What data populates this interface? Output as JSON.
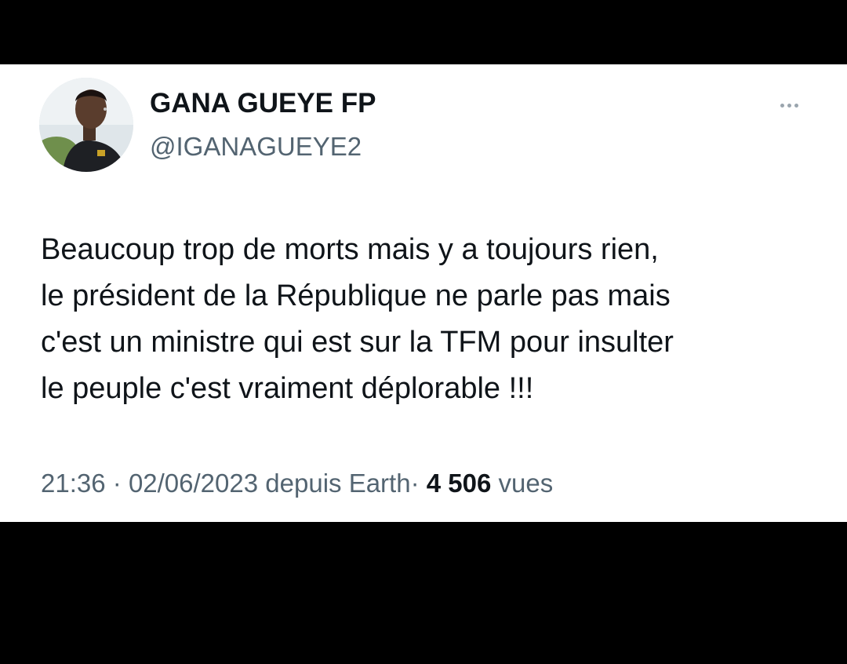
{
  "tweet": {
    "author": {
      "display_name": "GANA GUEYE FP",
      "handle": "@IGANAGUEYE2",
      "avatar": "profile-photo"
    },
    "more_icon": "more-horizontal-icon",
    "text_lines": [
      "Beaucoup trop de morts mais y a toujours rien,",
      "le président de la République ne parle pas mais",
      "c'est un ministre qui est sur la TFM pour insulter",
      "le peuple c'est vraiment déplorable !!!"
    ],
    "meta": {
      "time": "21:36",
      "separator": "·",
      "date": "02/06/2023",
      "source": "depuis Earth",
      "views_count": "4 506",
      "views_label": "vues"
    },
    "colors": {
      "background": "#000000",
      "card": "#ffffff",
      "text_primary": "#0f1419",
      "text_secondary": "#536471"
    }
  }
}
